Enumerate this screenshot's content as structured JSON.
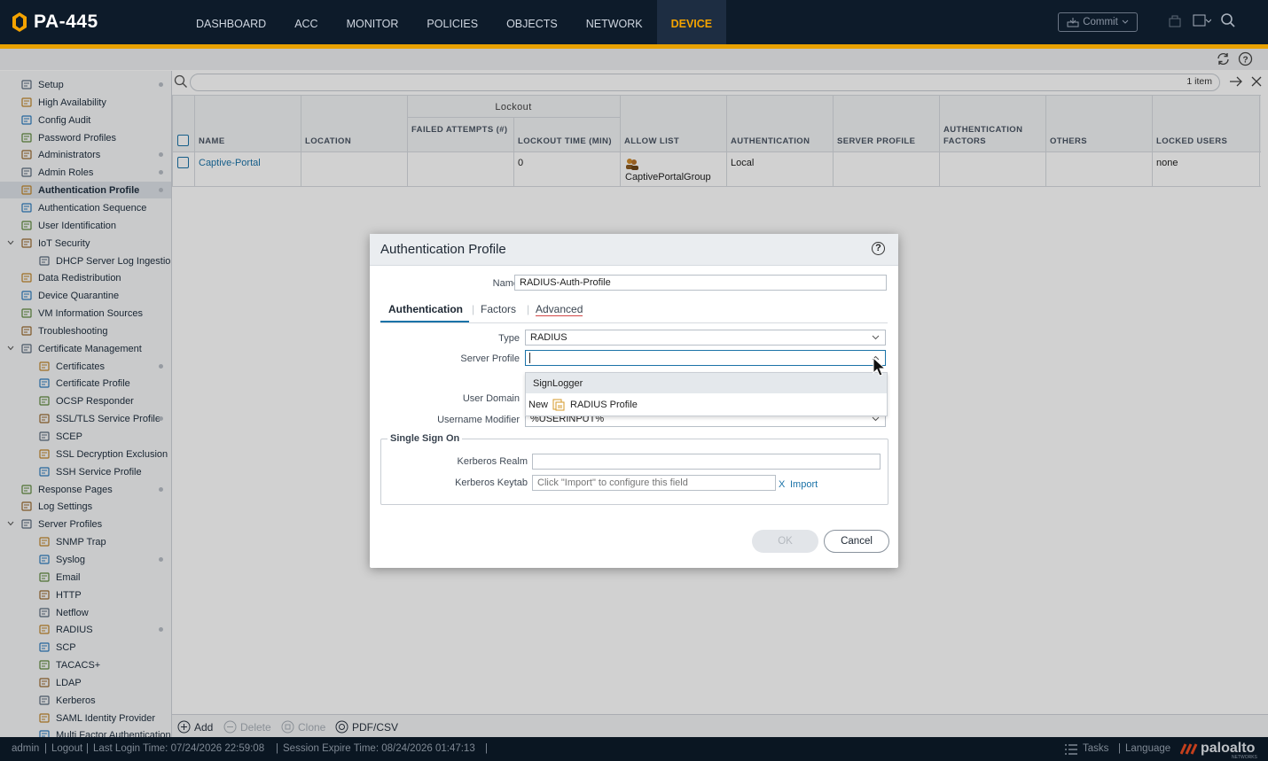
{
  "app": {
    "title": "PA-445",
    "brand_color": "#f4a300",
    "nav": [
      "DASHBOARD",
      "ACC",
      "MONITOR",
      "POLICIES",
      "OBJECTS",
      "NETWORK",
      "DEVICE"
    ],
    "active_nav": "DEVICE",
    "commit_label": "Commit"
  },
  "sidebar": {
    "items": [
      {
        "label": "Setup",
        "icon": "setup-icon",
        "dot": true
      },
      {
        "label": "High Availability",
        "icon": "high-availability-icon"
      },
      {
        "label": "Config Audit",
        "icon": "config-audit-icon"
      },
      {
        "label": "Password Profiles",
        "icon": "password-profiles-icon"
      },
      {
        "label": "Administrators",
        "icon": "administrators-icon",
        "dot": true
      },
      {
        "label": "Admin Roles",
        "icon": "admin-roles-icon",
        "dot": true
      },
      {
        "label": "Authentication Profile",
        "icon": "authentication-profile-icon",
        "dot": true,
        "active": true
      },
      {
        "label": "Authentication Sequence",
        "icon": "authentication-sequence-icon"
      },
      {
        "label": "User Identification",
        "icon": "user-identification-icon"
      },
      {
        "label": "IoT Security",
        "icon": "iot-security-icon",
        "expanded": true
      },
      {
        "label": "DHCP Server Log Ingestion",
        "icon": "dhcp-log-icon",
        "child": true
      },
      {
        "label": "Data Redistribution",
        "icon": "data-redistribution-icon"
      },
      {
        "label": "Device Quarantine",
        "icon": "device-quarantine-icon"
      },
      {
        "label": "VM Information Sources",
        "icon": "vm-information-icon"
      },
      {
        "label": "Troubleshooting",
        "icon": "troubleshooting-icon"
      },
      {
        "label": "Certificate Management",
        "icon": "certificate-management-icon",
        "expanded": true
      },
      {
        "label": "Certificates",
        "icon": "certificates-icon",
        "child": true,
        "dot": true
      },
      {
        "label": "Certificate Profile",
        "icon": "certificate-profile-icon",
        "child": true
      },
      {
        "label": "OCSP Responder",
        "icon": "ocsp-responder-icon",
        "child": true
      },
      {
        "label": "SSL/TLS Service Profile",
        "icon": "ssl-tls-profile-icon",
        "child": true,
        "dot": true
      },
      {
        "label": "SCEP",
        "icon": "scep-icon",
        "child": true
      },
      {
        "label": "SSL Decryption Exclusion",
        "icon": "ssl-decryption-icon",
        "child": true
      },
      {
        "label": "SSH Service Profile",
        "icon": "ssh-service-icon",
        "child": true
      },
      {
        "label": "Response Pages",
        "icon": "response-pages-icon",
        "dot": true
      },
      {
        "label": "Log Settings",
        "icon": "log-settings-icon"
      },
      {
        "label": "Server Profiles",
        "icon": "server-profiles-icon",
        "expanded": true
      },
      {
        "label": "SNMP Trap",
        "icon": "snmp-trap-icon",
        "child": true
      },
      {
        "label": "Syslog",
        "icon": "syslog-icon",
        "child": true,
        "dot": true
      },
      {
        "label": "Email",
        "icon": "email-icon",
        "child": true
      },
      {
        "label": "HTTP",
        "icon": "http-icon",
        "child": true
      },
      {
        "label": "Netflow",
        "icon": "netflow-icon",
        "child": true
      },
      {
        "label": "RADIUS",
        "icon": "radius-icon",
        "child": true,
        "dot": true
      },
      {
        "label": "SCP",
        "icon": "scp-icon",
        "child": true
      },
      {
        "label": "TACACS+",
        "icon": "tacacs-icon",
        "child": true
      },
      {
        "label": "LDAP",
        "icon": "ldap-icon",
        "child": true
      },
      {
        "label": "Kerberos",
        "icon": "kerberos-icon",
        "child": true
      },
      {
        "label": "SAML Identity Provider",
        "icon": "saml-icon",
        "child": true
      },
      {
        "label": "Multi Factor Authentication",
        "icon": "mfa-icon",
        "child": true
      }
    ]
  },
  "search": {
    "count": "1 item"
  },
  "table": {
    "group_header": "Lockout",
    "headers": {
      "name": "NAME",
      "location": "LOCATION",
      "failed_attempts": "FAILED ATTEMPTS (#)",
      "lockout_time": "LOCKOUT TIME (MIN)",
      "allow_list": "ALLOW LIST",
      "authentication": "AUTHENTICATION",
      "server_profile": "SERVER PROFILE",
      "auth_factors": "AUTHENTICATION FACTORS",
      "others": "OTHERS",
      "locked_users": "LOCKED USERS"
    },
    "rows": [
      {
        "name": "Captive-Portal",
        "location": "",
        "failed_attempts": "",
        "lockout_time": "0",
        "allow_list": "CaptivePortalGroup",
        "authentication": "Local",
        "server_profile": "",
        "auth_factors": "",
        "others": "",
        "locked_users": "none"
      }
    ]
  },
  "actions": {
    "add": "Add",
    "delete": "Delete",
    "clone": "Clone",
    "pdf": "PDF/CSV"
  },
  "status": {
    "user": "admin",
    "logout": "Logout",
    "last_login": "Last Login Time: 07/24/2026 22:59:08",
    "session_expire": "Session Expire Time: 08/24/2026 01:47:13",
    "tasks": "Tasks",
    "language": "Language",
    "brand": "paloalto",
    "brand_sub": "NETWORKS"
  },
  "modal": {
    "title": "Authentication Profile",
    "name_label": "Name",
    "name_value": "RADIUS-Auth-Profile",
    "tabs": [
      "Authentication",
      "Factors",
      "Advanced"
    ],
    "type_label": "Type",
    "type_value": "RADIUS",
    "server_profile_label": "Server Profile",
    "server_profile_value": "",
    "dropdown_options": [
      "SignLogger"
    ],
    "new_prefix": "New",
    "new_item_label": "RADIUS Profile",
    "user_domain_label": "User Domain",
    "username_modifier_label": "Username Modifier",
    "username_modifier_value": "%USERINPUT%",
    "sso_legend": "Single Sign On",
    "kerberos_realm_label": "Kerberos Realm",
    "kerberos_keytab_label": "Kerberos Keytab",
    "kerberos_keytab_placeholder": "Click \"Import\" to configure this field",
    "import_x": "X",
    "import_label": "Import",
    "ok_label": "OK",
    "cancel_label": "Cancel"
  }
}
